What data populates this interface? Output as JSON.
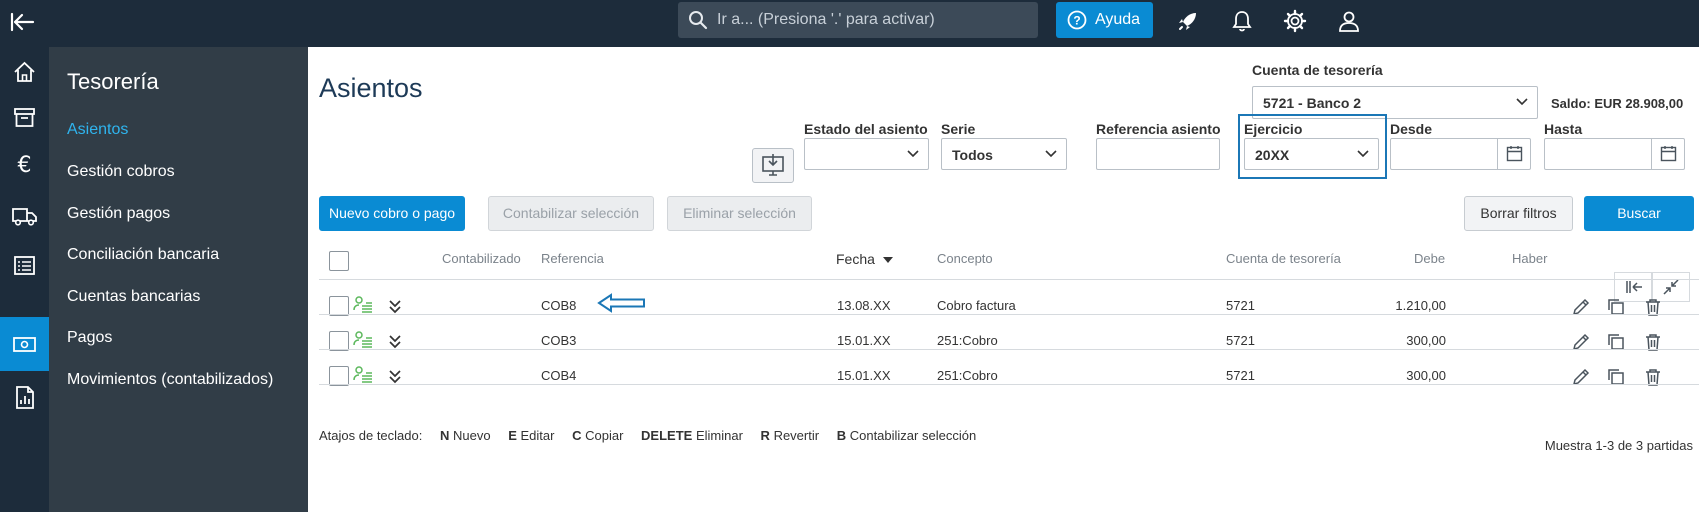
{
  "topbar": {
    "search_placeholder": "Ir a... (Presiona '.' para activar)",
    "help_label": "Ayuda",
    "icons": [
      "back-arrow-icon",
      "search-icon",
      "help-icon",
      "rocket-icon",
      "bell-icon",
      "gear-icon",
      "user-icon"
    ]
  },
  "rail": {
    "icons": [
      "home-icon",
      "archive-icon",
      "euro-icon",
      "truck-icon",
      "list-icon",
      "money-icon",
      "report-icon"
    ],
    "active_index": 5
  },
  "sidebar": {
    "title": "Tesorería",
    "items": [
      {
        "label": "Asientos",
        "selected": true
      },
      {
        "label": "Gestión cobros"
      },
      {
        "label": "Gestión pagos"
      },
      {
        "label": "Conciliación bancaria"
      },
      {
        "label": "Cuentas bancarias"
      },
      {
        "label": "Pagos"
      },
      {
        "label": "Movimientos (contabilizados)"
      }
    ]
  },
  "main": {
    "title": "Asientos",
    "cuenta": {
      "label": "Cuenta de tesorería",
      "value": "5721 - Banco 2"
    },
    "saldo": "Saldo: EUR 28.908,00",
    "filters": {
      "estado": {
        "label": "Estado del asiento",
        "value": ""
      },
      "serie": {
        "label": "Serie",
        "value": "Todos"
      },
      "referencia": {
        "label": "Referencia asiento",
        "value": ""
      },
      "ejercicio": {
        "label": "Ejercicio",
        "value": "20XX"
      },
      "desde": {
        "label": "Desde",
        "value": ""
      },
      "hasta": {
        "label": "Hasta",
        "value": ""
      }
    },
    "buttons": {
      "nuevo": "Nuevo cobro o pago",
      "contabilizar": "Contabilizar selección",
      "eliminar": "Eliminar selección",
      "borrar": "Borrar filtros",
      "buscar": "Buscar"
    },
    "table": {
      "columns": [
        "Contabilizado",
        "Referencia",
        "Fecha",
        "Concepto",
        "Cuenta de tesorería",
        "Debe",
        "Haber"
      ],
      "rows": [
        {
          "referencia": "COB8",
          "fecha": "13.08.XX",
          "concepto": "Cobro factura",
          "cuenta": "5721",
          "debe": "1.210,00",
          "haber": ""
        },
        {
          "referencia": "COB3",
          "fecha": "15.01.XX",
          "concepto": "251:Cobro",
          "cuenta": "5721",
          "debe": "300,00",
          "haber": ""
        },
        {
          "referencia": "COB4",
          "fecha": "15.01.XX",
          "concepto": "251:Cobro",
          "cuenta": "5721",
          "debe": "300,00",
          "haber": ""
        }
      ]
    },
    "shortcuts": {
      "label": "Atajos de teclado:",
      "items": [
        {
          "key": "N",
          "action": "Nuevo"
        },
        {
          "key": "E",
          "action": "Editar"
        },
        {
          "key": "C",
          "action": "Copiar"
        },
        {
          "key": "DELETE",
          "action": "Eliminar"
        },
        {
          "key": "R",
          "action": "Revertir"
        },
        {
          "key": "B",
          "action": "Contabilizar selección"
        }
      ]
    },
    "count": "Muestra 1-3 de 3 partidas"
  },
  "colors": {
    "accent": "#0a8bd3",
    "topbar": "#1d2c3b",
    "sidebar": "#313d47",
    "selected": "#2fb4ee",
    "success": "#5cb85c"
  }
}
